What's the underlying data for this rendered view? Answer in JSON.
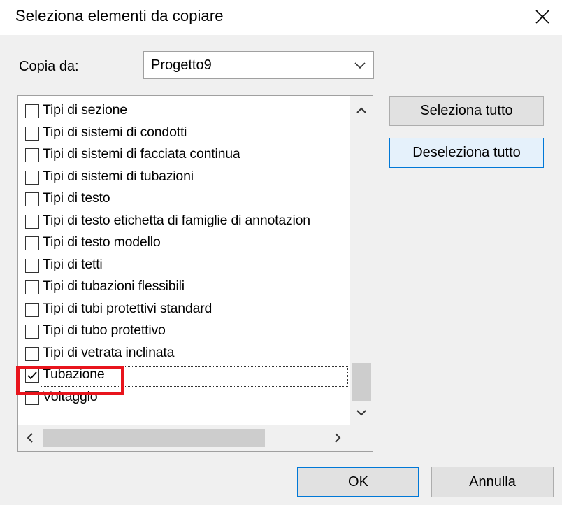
{
  "dialog": {
    "title": "Seleziona elementi da copiare",
    "close_icon": "close-icon"
  },
  "copy_from": {
    "label": "Copia da:",
    "value": "Progetto9"
  },
  "list": {
    "items": [
      {
        "label": "Tipi di sezione",
        "checked": false
      },
      {
        "label": "Tipi di sistemi di condotti",
        "checked": false
      },
      {
        "label": "Tipi di sistemi di facciata continua",
        "checked": false
      },
      {
        "label": "Tipi di sistemi di tubazioni",
        "checked": false
      },
      {
        "label": "Tipi di testo",
        "checked": false
      },
      {
        "label": "Tipi di testo etichetta di famiglie di annotazion",
        "checked": false
      },
      {
        "label": "Tipi di testo modello",
        "checked": false
      },
      {
        "label": "Tipi di tetti",
        "checked": false
      },
      {
        "label": "Tipi di tubazioni flessibili",
        "checked": false
      },
      {
        "label": "Tipi di tubi protettivi standard",
        "checked": false
      },
      {
        "label": "Tipi di tubo protettivo",
        "checked": false
      },
      {
        "label": "Tipi di vetrata inclinata",
        "checked": false
      },
      {
        "label": "Tubazione",
        "checked": true
      },
      {
        "label": "Voltaggio",
        "checked": false
      }
    ]
  },
  "buttons": {
    "select_all": "Seleziona tutto",
    "deselect_all": "Deseleziona tutto",
    "ok": "OK",
    "cancel": "Annulla"
  },
  "colors": {
    "accent": "#0078d7",
    "highlight": "#e8141c"
  }
}
